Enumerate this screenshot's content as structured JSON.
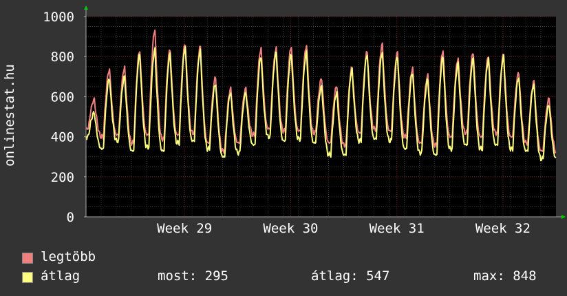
{
  "chart_data": {
    "type": "line",
    "ylabel": "onlinestat.hu",
    "ylim": [
      0,
      1000
    ],
    "yticks": [
      0,
      200,
      400,
      600,
      800,
      1000
    ],
    "x_tick_labels": [
      "Week 29",
      "Week 30",
      "Week 31",
      "Week 32"
    ],
    "x_range_days": [
      0,
      31
    ],
    "grid": true,
    "background": "#000000",
    "series": [
      {
        "name": "legtöbb",
        "color": "#f08080",
        "daily_peaks": [
          585,
          735,
          745,
          830,
          935,
          835,
          865,
          850,
          695,
          640,
          640,
          840,
          840,
          850,
          855,
          690,
          655,
          745,
          825,
          860,
          820,
          740,
          705,
          830,
          790,
          820,
          805,
          810,
          720,
          675,
          590
        ],
        "troughs": [
          440,
          400,
          410,
          370,
          410,
          390,
          410,
          420,
          370,
          330,
          370,
          410,
          440,
          430,
          430,
          420,
          370,
          360,
          420,
          440,
          430,
          400,
          370,
          360,
          400,
          420,
          400,
          420,
          400,
          370,
          330
        ],
        "end_value": 320
      },
      {
        "name": "átlag",
        "color": "#ffff80",
        "daily_peaks": [
          520,
          690,
          700,
          810,
          835,
          810,
          845,
          830,
          665,
          620,
          620,
          800,
          820,
          810,
          820,
          650,
          620,
          735,
          810,
          820,
          800,
          720,
          685,
          800,
          765,
          790,
          785,
          800,
          695,
          660,
          560
        ],
        "troughs": [
          400,
          340,
          380,
          330,
          350,
          330,
          370,
          380,
          340,
          300,
          320,
          360,
          400,
          380,
          390,
          370,
          310,
          310,
          380,
          390,
          380,
          340,
          320,
          310,
          340,
          360,
          340,
          360,
          340,
          330,
          290
        ],
        "end_value": 295
      }
    ]
  },
  "legend": {
    "max_label": "legtöbb",
    "avg_label": "átlag",
    "now_text": "most: 295",
    "avg_text": "átlag: 547",
    "max_text": "max: 848"
  }
}
